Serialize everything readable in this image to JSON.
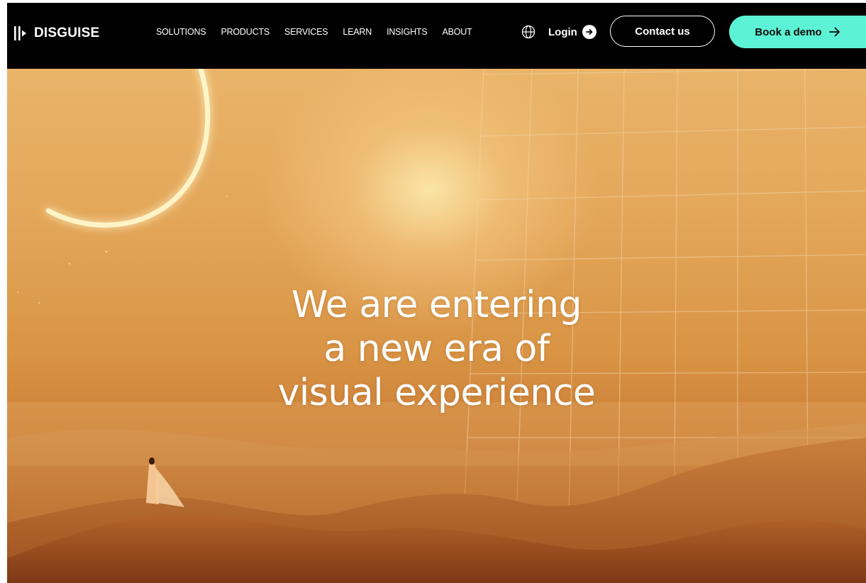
{
  "header": {
    "logo_text": "DISGUISE",
    "nav": [
      "SOLUTIONS",
      "PRODUCTS",
      "SERVICES",
      "LEARN",
      "INSIGHTS",
      "ABOUT"
    ],
    "login_label": "Login",
    "contact_label": "Contact us",
    "demo_label": "Book a demo"
  },
  "hero": {
    "headline_lines": [
      "We are entering",
      "a new era of",
      "visual experience"
    ]
  },
  "colors": {
    "header_bg": "#000000",
    "accent": "#5cf2d6",
    "hero_tone": "#d99445"
  },
  "icons": [
    "logo-mark-icon",
    "globe-icon",
    "arrow-circle-right-icon",
    "arrow-right-icon"
  ]
}
